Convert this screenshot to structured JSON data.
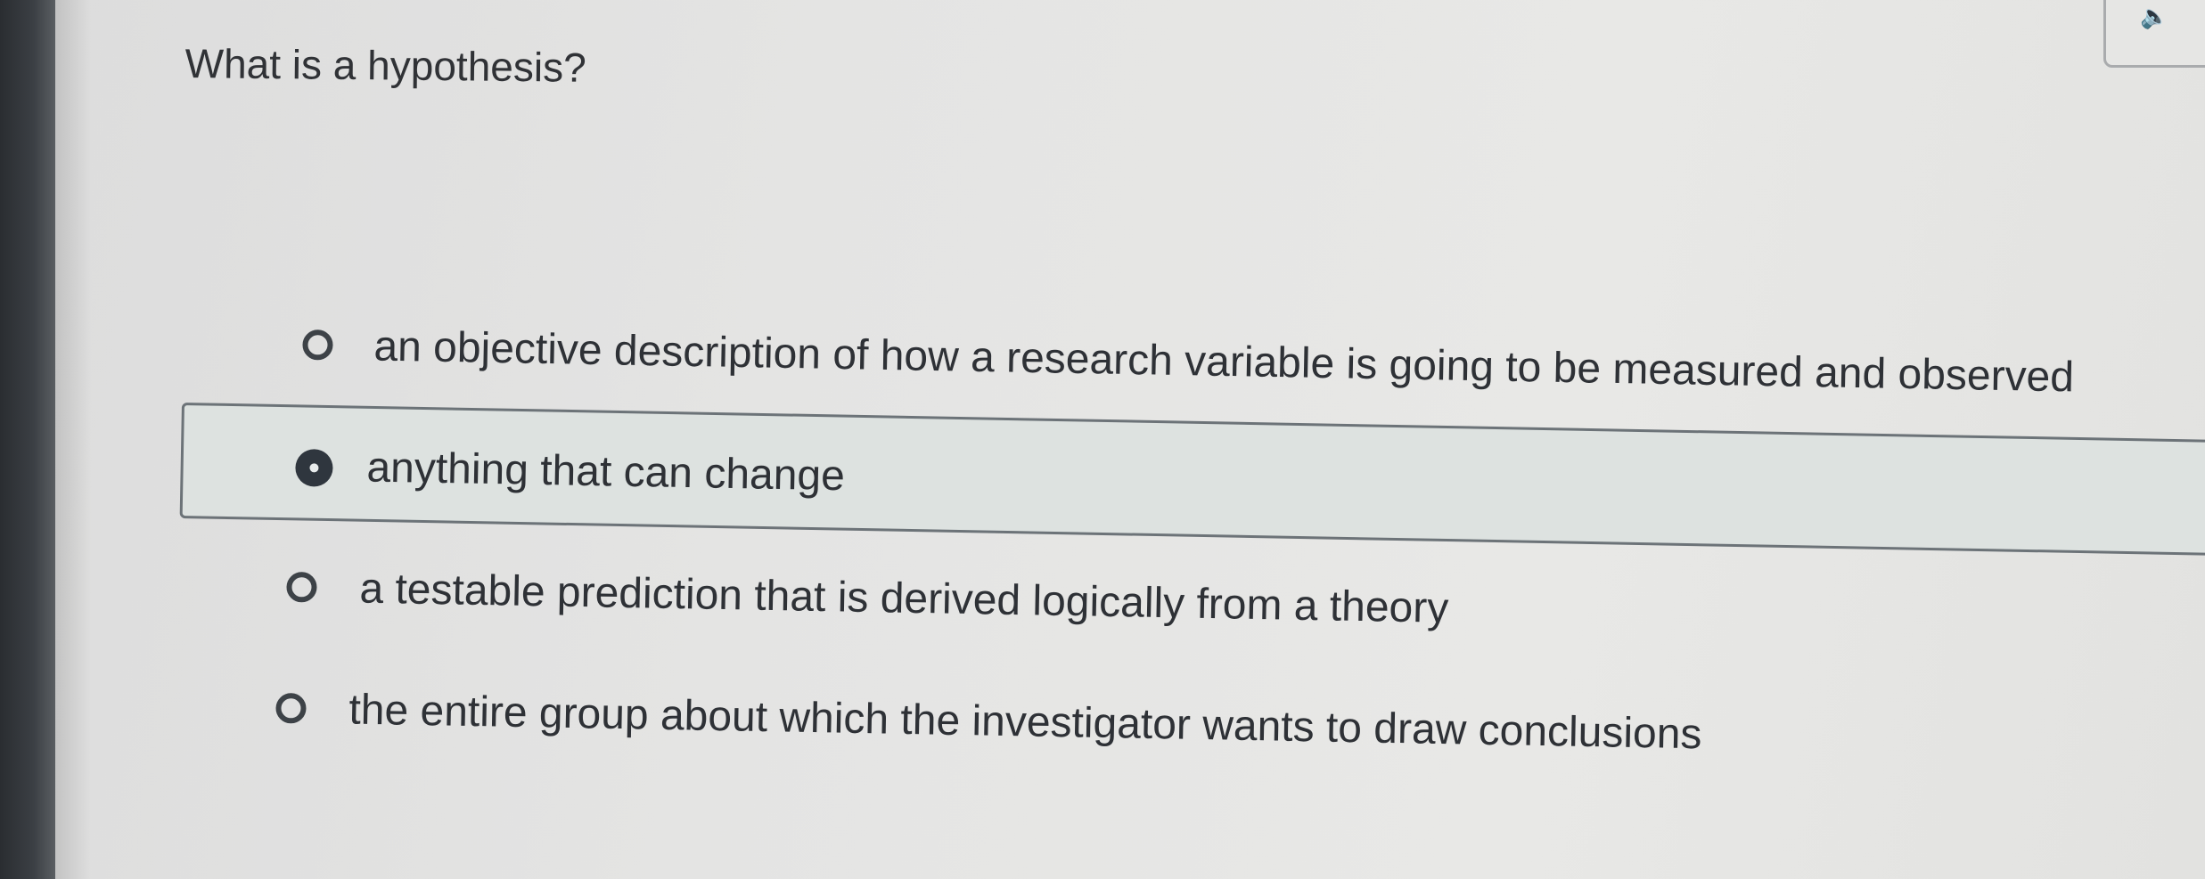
{
  "question": {
    "text": "What is a hypothesis?"
  },
  "audio_button": {
    "icon": "speaker-icon"
  },
  "options": [
    {
      "label": "an objective description of how a research variable is going to be measured and observed",
      "selected": false
    },
    {
      "label": "anything that can change",
      "selected": true
    },
    {
      "label": "a testable prediction that is derived logically from a theory",
      "selected": false
    },
    {
      "label": "the entire group about which the investigator wants to draw conclusions",
      "selected": false
    }
  ],
  "colors": {
    "background": "#e4e4e3",
    "text": "#2e3136",
    "selected_bg": "#dde2e0",
    "selected_border": "#6c7378",
    "radio_fill": "#2f363e"
  }
}
